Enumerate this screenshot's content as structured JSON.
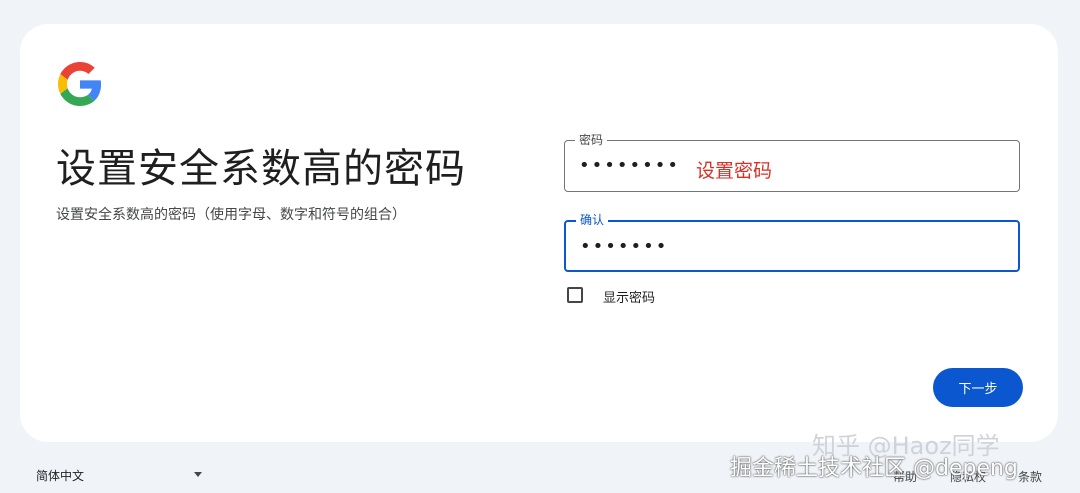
{
  "page": {
    "title": "设置安全系数高的密码",
    "subtitle": "设置安全系数高的密码（使用字母、数字和符号的组合）"
  },
  "form": {
    "password": {
      "label": "密码",
      "value": "••••••••"
    },
    "annotation": "设置密码",
    "confirm": {
      "label": "确认",
      "value": "•••••••"
    },
    "show_password_label": "显示密码",
    "next_button": "下一步"
  },
  "footer": {
    "language": "简体中文",
    "links": [
      "帮助",
      "隐私权",
      "条款"
    ]
  },
  "watermarks": {
    "zhihu": "知乎 @Haoz同学",
    "juejin": "掘金稀土技术社区 @depeng"
  },
  "colors": {
    "primary": "#0b57d0",
    "background": "#f0f4f9",
    "annotation": "#d93025"
  },
  "icons": {
    "logo": "google-g-logo"
  }
}
